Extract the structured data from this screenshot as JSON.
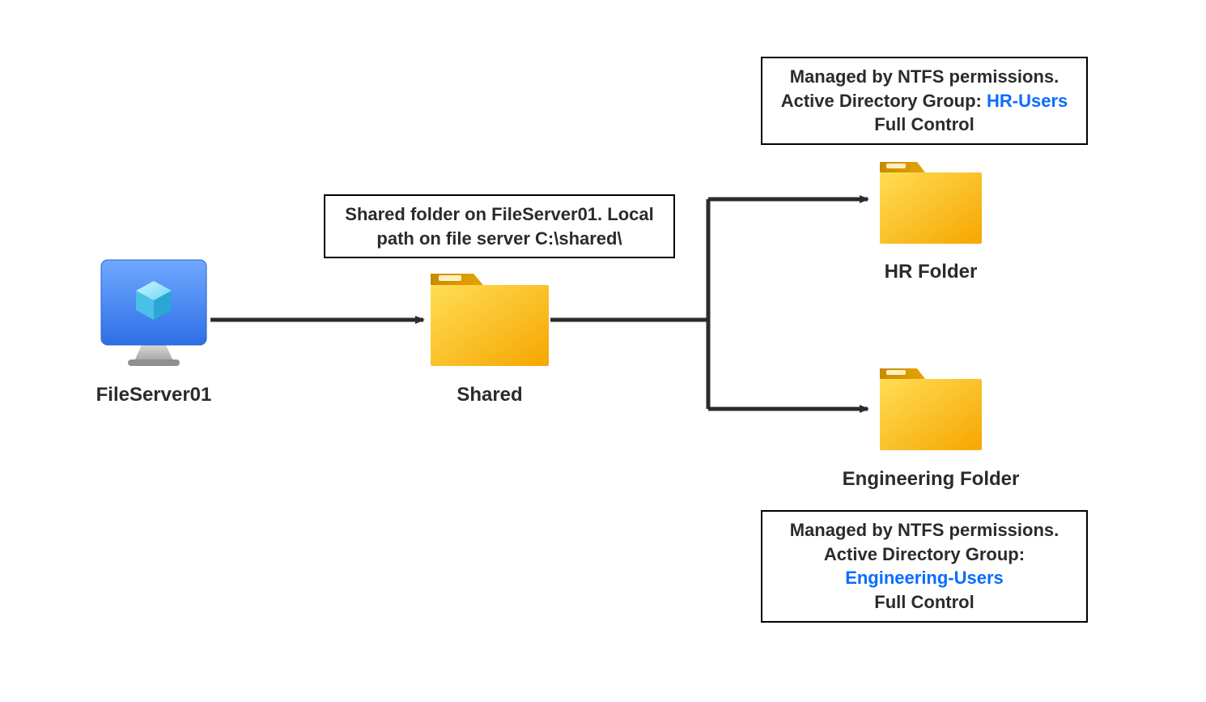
{
  "server": {
    "label": "FileServer01"
  },
  "sharedFolder": {
    "label": "Shared",
    "note": "Shared folder on FileServer01. Local path on file server C:\\shared\\"
  },
  "hrFolder": {
    "label": "HR Folder",
    "note_line1": "Managed by NTFS permissions.",
    "note_line2_prefix": "Active Directory Group: ",
    "note_line2_group": "HR-Users",
    "note_line3": "Full Control"
  },
  "engFolder": {
    "label": "Engineering Folder",
    "note_line1": "Managed by NTFS permissions.",
    "note_line2_prefix": "Active Directory Group:",
    "note_line2_group": "Engineering-Users",
    "note_line3": "Full Control"
  }
}
